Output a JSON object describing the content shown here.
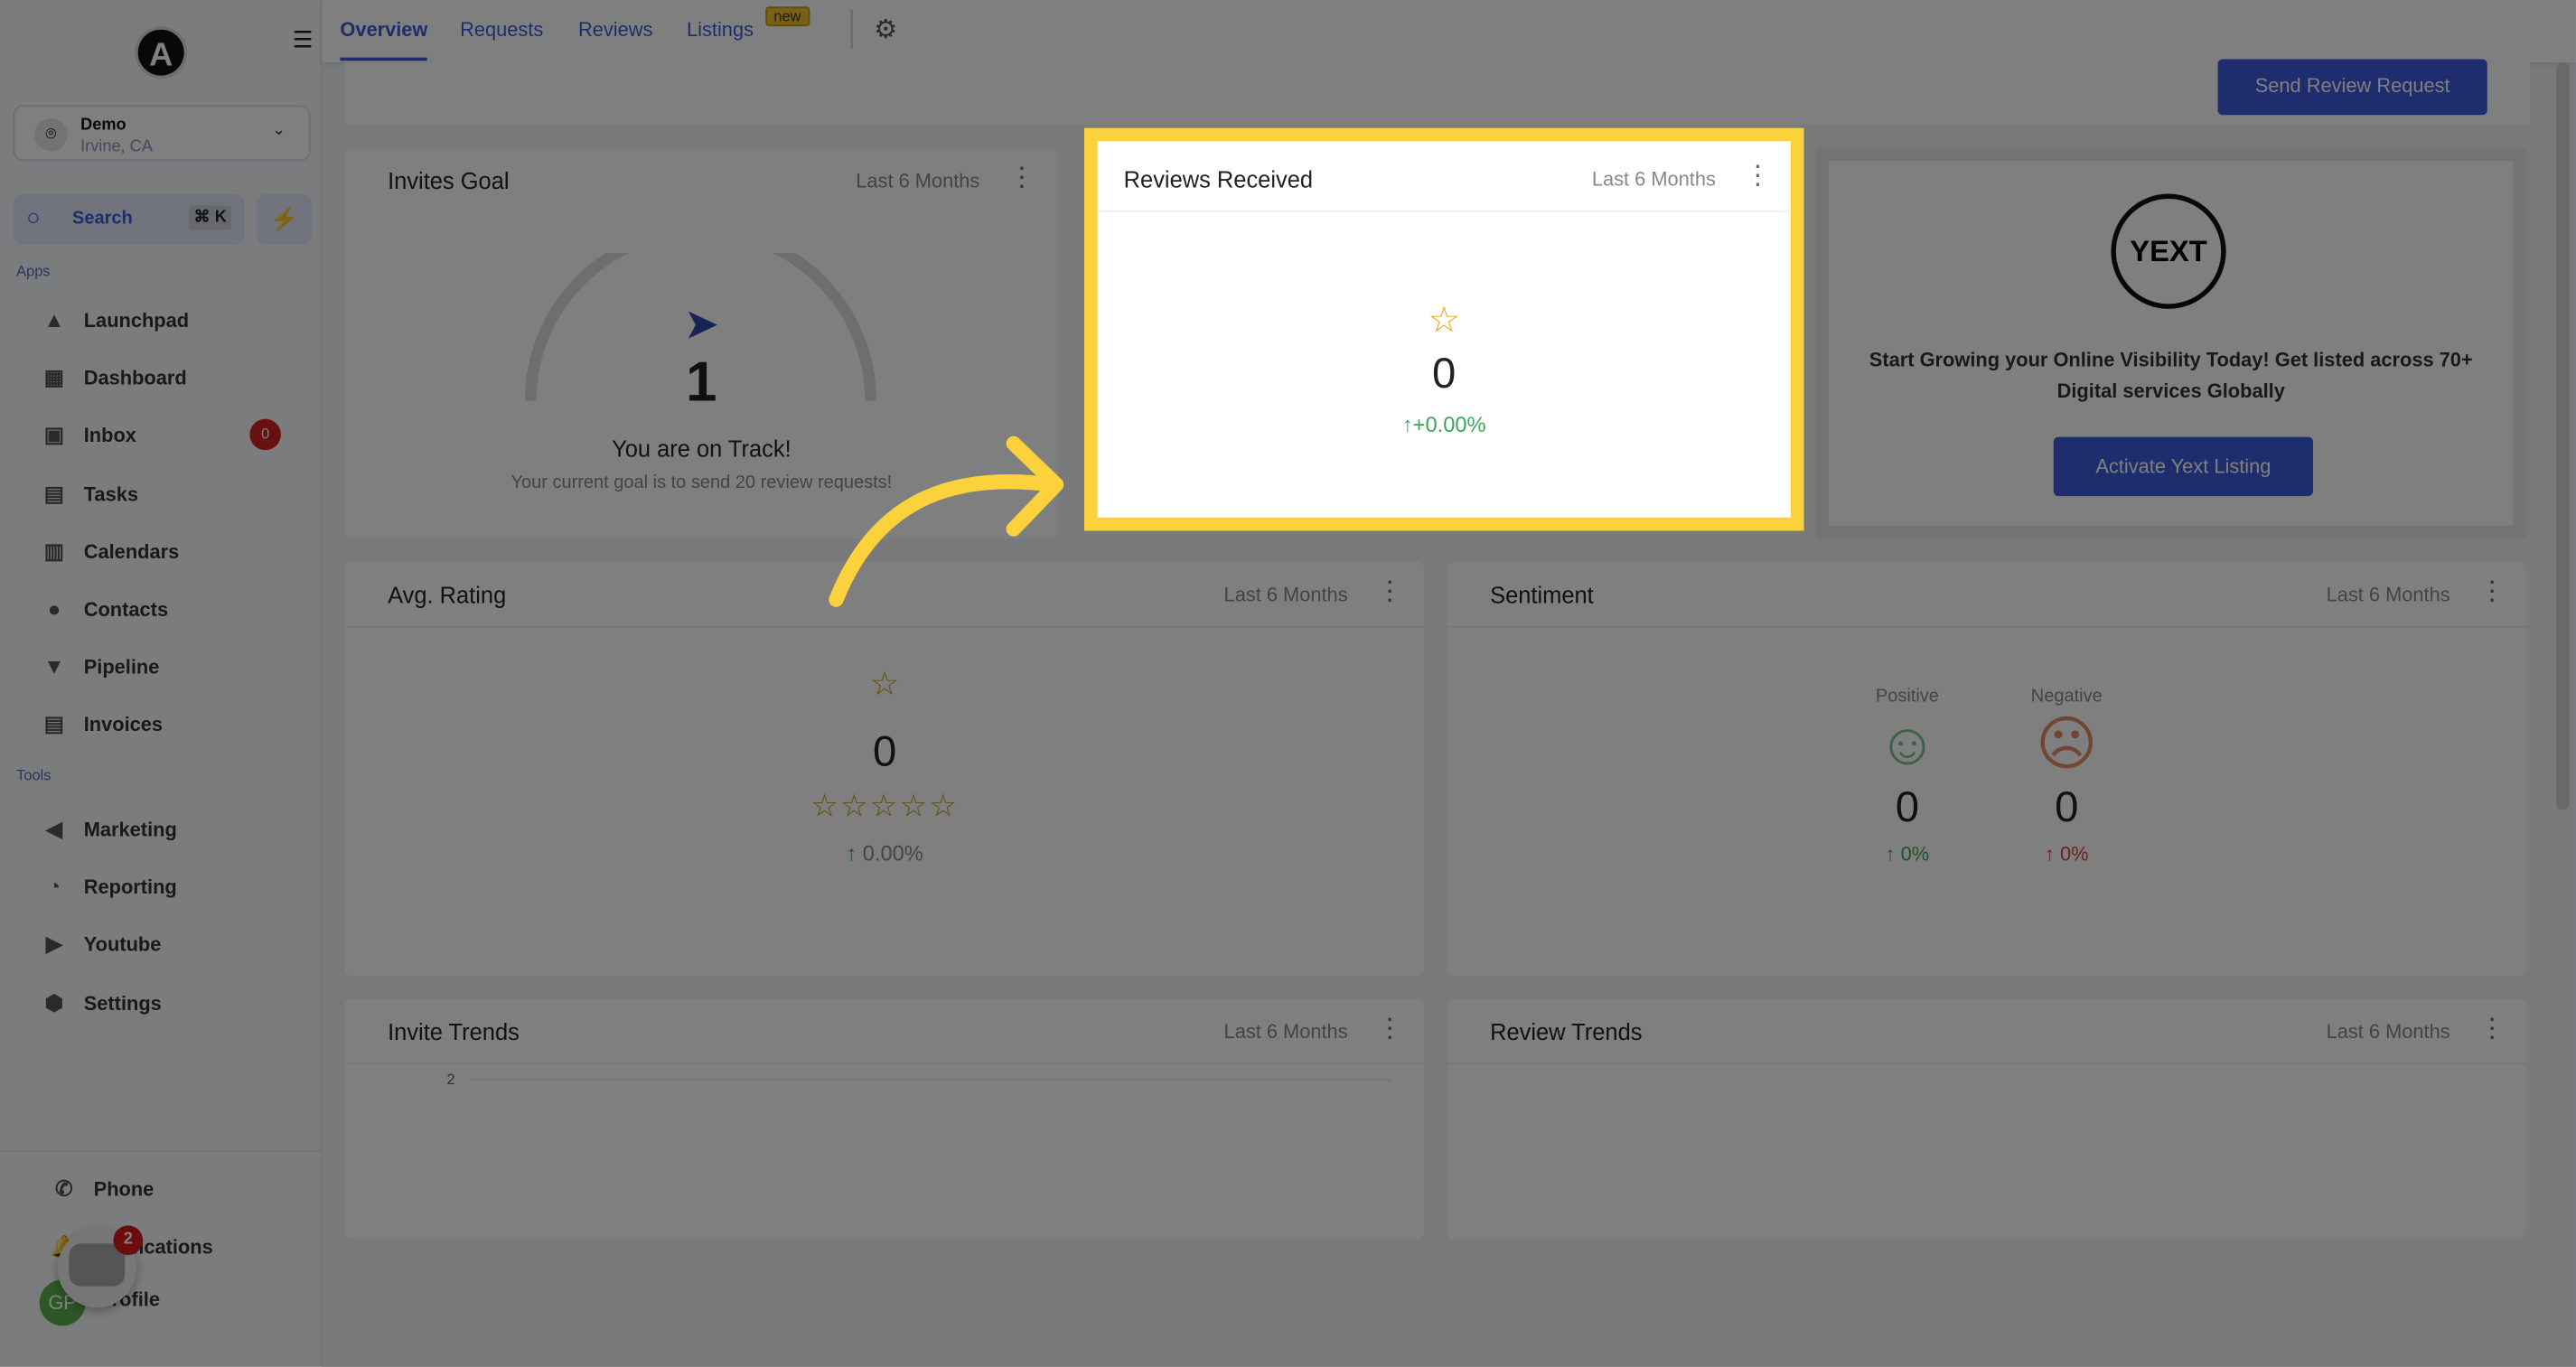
{
  "sidebar": {
    "location": {
      "name": "Demo",
      "city": "Irvine, CA"
    },
    "search": {
      "label": "Search",
      "shortcut": "⌘ K"
    },
    "apps_label": "Apps",
    "tools_label": "Tools",
    "apps": [
      {
        "label": "Launchpad",
        "icon": "rocket-icon"
      },
      {
        "label": "Dashboard",
        "icon": "grid-icon"
      },
      {
        "label": "Inbox",
        "icon": "inbox-icon",
        "badge": "0"
      },
      {
        "label": "Tasks",
        "icon": "clipboard-icon"
      },
      {
        "label": "Calendars",
        "icon": "calendar-icon"
      },
      {
        "label": "Contacts",
        "icon": "person-icon"
      },
      {
        "label": "Pipeline",
        "icon": "funnel-icon"
      },
      {
        "label": "Invoices",
        "icon": "invoice-icon"
      }
    ],
    "tools": [
      {
        "label": "Marketing",
        "icon": "megaphone-icon"
      },
      {
        "label": "Reporting",
        "icon": "pie-icon"
      },
      {
        "label": "Youtube",
        "icon": "youtube-icon"
      },
      {
        "label": "Settings",
        "icon": "gear-icon"
      }
    ],
    "bottom": [
      {
        "label": "Phone"
      },
      {
        "label": "Notifications"
      },
      {
        "label": "Profile"
      }
    ],
    "avatar": "GP",
    "chat_count": "2"
  },
  "tabs": [
    {
      "label": "Overview",
      "active": true
    },
    {
      "label": "Requests"
    },
    {
      "label": "Reviews"
    },
    {
      "label": "Listings",
      "badge": "new"
    }
  ],
  "send_button": "Send Review Request",
  "period": "Last 6 Months",
  "invites_goal": {
    "title": "Invites Goal",
    "value": "1",
    "status": "You are on Track!",
    "note": "Your current goal is to send 20 review requests!"
  },
  "reviews_received": {
    "title": "Reviews Received",
    "value": "0",
    "change": "+0.00%"
  },
  "yext": {
    "logo": "YEXT",
    "text": "Start Growing your Online Visibility Today! Get listed across 70+ Digital services Globally",
    "button": "Activate Yext Listing"
  },
  "avg_rating": {
    "title": "Avg. Rating",
    "value": "0",
    "stars": 0,
    "change": "0.00%"
  },
  "sentiment": {
    "title": "Sentiment",
    "positive_label": "Positive",
    "negative_label": "Negative",
    "positive": "0",
    "negative": "0",
    "positive_change": "0%",
    "negative_change": "0%"
  },
  "invite_trends": {
    "title": "Invite Trends",
    "y_tick": "2"
  },
  "review_trends": {
    "title": "Review Trends"
  },
  "colors": {
    "accent": "#3b5bdb",
    "highlight": "#fcd23c",
    "positive": "#3aa757",
    "negative": "#d9453d"
  }
}
